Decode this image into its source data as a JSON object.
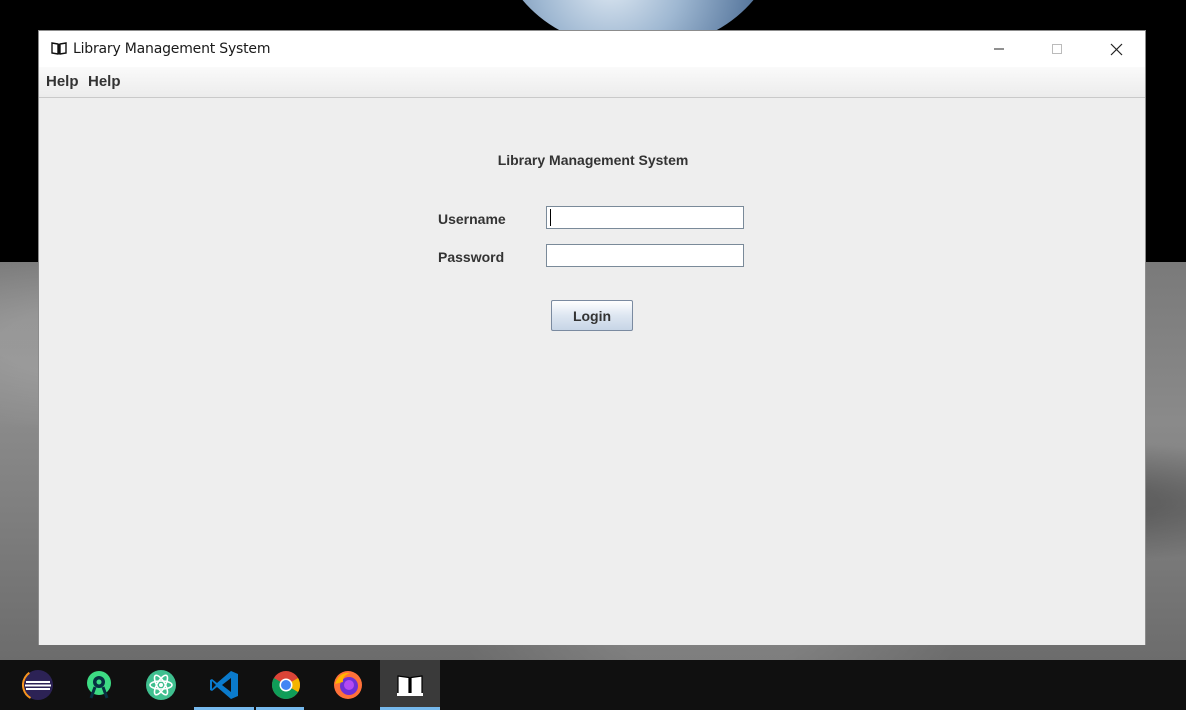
{
  "window": {
    "title": "Library Management System",
    "menu": [
      "Help",
      "Help"
    ]
  },
  "form": {
    "heading": "Library Management System",
    "username_label": "Username",
    "username_value": "",
    "password_label": "Password",
    "password_value": "",
    "login_label": "Login"
  },
  "taskbar": {
    "apps": [
      {
        "icon": "eclipse-icon",
        "state": "normal"
      },
      {
        "icon": "android-studio-icon",
        "state": "normal"
      },
      {
        "icon": "atom-icon",
        "state": "normal"
      },
      {
        "icon": "vscode-icon",
        "state": "running"
      },
      {
        "icon": "chrome-icon",
        "state": "running"
      },
      {
        "icon": "firefox-icon",
        "state": "normal"
      },
      {
        "icon": "library-app-icon",
        "state": "active"
      }
    ]
  },
  "colors": {
    "window_bg": "#eeeeee",
    "taskbar_bg": "#101010",
    "running_indicator": "#76b9ed"
  }
}
